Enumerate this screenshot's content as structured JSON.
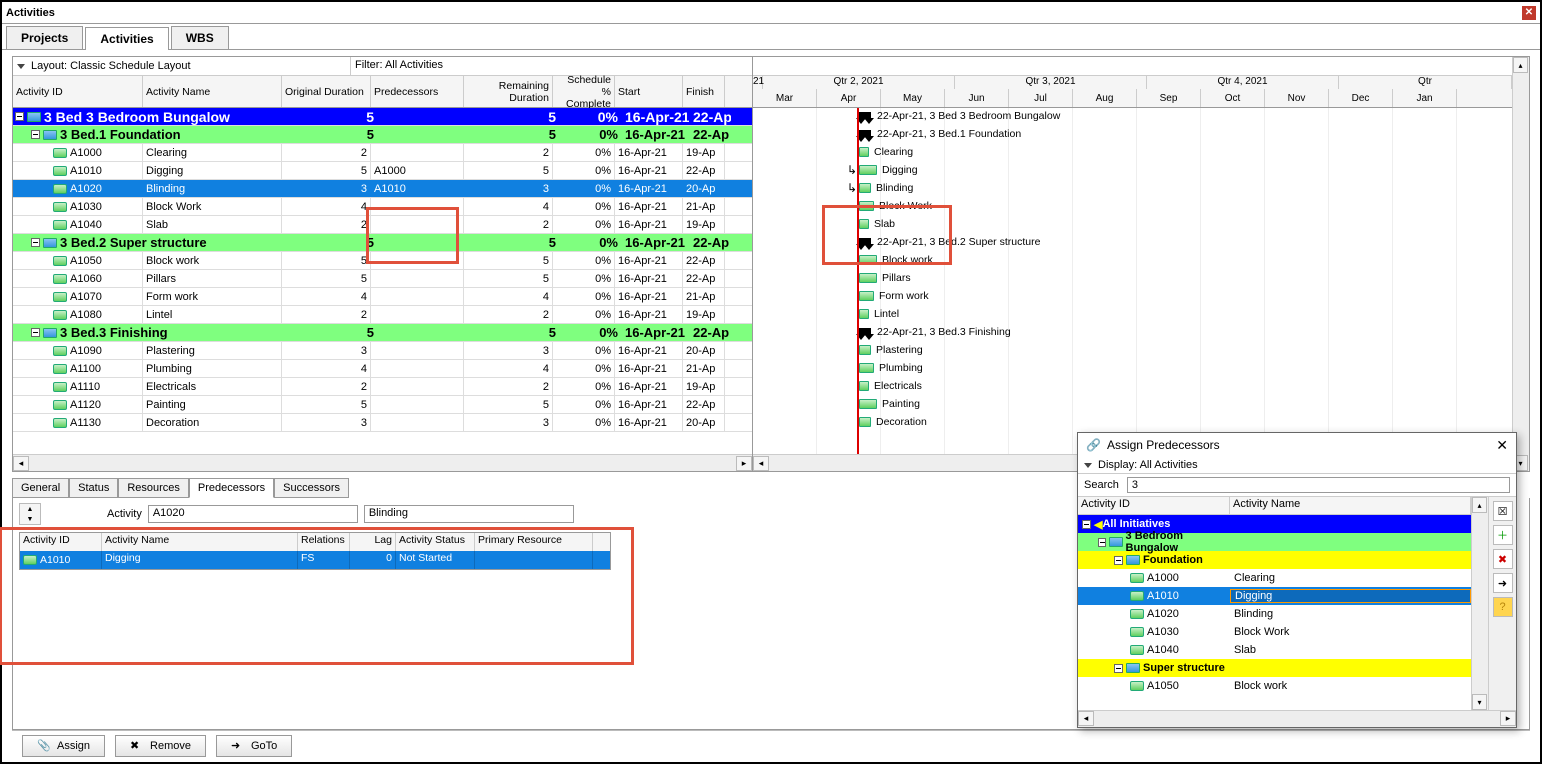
{
  "window": {
    "title": "Activities"
  },
  "tabs": [
    "Projects",
    "Activities",
    "WBS"
  ],
  "activeTab": 1,
  "layoutBar": {
    "layout": "Layout: Classic Schedule Layout",
    "filter": "Filter: All Activities"
  },
  "columns": {
    "id": "Activity ID",
    "name": "Activity Name",
    "od": "Original Duration",
    "pred": "Predecessors",
    "rd": "Remaining Duration",
    "sc": "Schedule % Complete",
    "start": "Start",
    "finish": "Finish"
  },
  "rows": [
    {
      "type": "wbs0",
      "indent": 0,
      "id": "3 Bed",
      "name": "3 Bedroom Bungalow",
      "od": "5",
      "pred": "",
      "rd": "5",
      "sc": "0%",
      "start": "16-Apr-21",
      "finish": "22-Ap"
    },
    {
      "type": "wbs1",
      "indent": 1,
      "id": "3 Bed.1",
      "name": "Foundation",
      "od": "5",
      "pred": "",
      "rd": "5",
      "sc": "0%",
      "start": "16-Apr-21",
      "finish": "22-Ap"
    },
    {
      "type": "act",
      "indent": 2,
      "id": "A1000",
      "name": "Clearing",
      "od": "2",
      "pred": "",
      "rd": "2",
      "sc": "0%",
      "start": "16-Apr-21",
      "finish": "19-Ap"
    },
    {
      "type": "act",
      "indent": 2,
      "id": "A1010",
      "name": "Digging",
      "od": "5",
      "pred": "A1000",
      "rd": "5",
      "sc": "0%",
      "start": "16-Apr-21",
      "finish": "22-Ap"
    },
    {
      "type": "sel",
      "indent": 2,
      "id": "A1020",
      "name": "Blinding",
      "od": "3",
      "pred": "A1010",
      "rd": "3",
      "sc": "0%",
      "start": "16-Apr-21",
      "finish": "20-Ap"
    },
    {
      "type": "act",
      "indent": 2,
      "id": "A1030",
      "name": "Block Work",
      "od": "4",
      "pred": "",
      "rd": "4",
      "sc": "0%",
      "start": "16-Apr-21",
      "finish": "21-Ap"
    },
    {
      "type": "act",
      "indent": 2,
      "id": "A1040",
      "name": "Slab",
      "od": "2",
      "pred": "",
      "rd": "2",
      "sc": "0%",
      "start": "16-Apr-21",
      "finish": "19-Ap"
    },
    {
      "type": "wbs1",
      "indent": 1,
      "id": "3 Bed.2",
      "name": "Super structure",
      "od": "5",
      "pred": "",
      "rd": "5",
      "sc": "0%",
      "start": "16-Apr-21",
      "finish": "22-Ap"
    },
    {
      "type": "act",
      "indent": 2,
      "id": "A1050",
      "name": "Block work",
      "od": "5",
      "pred": "",
      "rd": "5",
      "sc": "0%",
      "start": "16-Apr-21",
      "finish": "22-Ap"
    },
    {
      "type": "act",
      "indent": 2,
      "id": "A1060",
      "name": "Pillars",
      "od": "5",
      "pred": "",
      "rd": "5",
      "sc": "0%",
      "start": "16-Apr-21",
      "finish": "22-Ap"
    },
    {
      "type": "act",
      "indent": 2,
      "id": "A1070",
      "name": "Form work",
      "od": "4",
      "pred": "",
      "rd": "4",
      "sc": "0%",
      "start": "16-Apr-21",
      "finish": "21-Ap"
    },
    {
      "type": "act",
      "indent": 2,
      "id": "A1080",
      "name": "Lintel",
      "od": "2",
      "pred": "",
      "rd": "2",
      "sc": "0%",
      "start": "16-Apr-21",
      "finish": "19-Ap"
    },
    {
      "type": "wbs1",
      "indent": 1,
      "id": "3 Bed.3",
      "name": "Finishing",
      "od": "5",
      "pred": "",
      "rd": "5",
      "sc": "0%",
      "start": "16-Apr-21",
      "finish": "22-Ap"
    },
    {
      "type": "act",
      "indent": 2,
      "id": "A1090",
      "name": "Plastering",
      "od": "3",
      "pred": "",
      "rd": "3",
      "sc": "0%",
      "start": "16-Apr-21",
      "finish": "20-Ap"
    },
    {
      "type": "act",
      "indent": 2,
      "id": "A1100",
      "name": "Plumbing",
      "od": "4",
      "pred": "",
      "rd": "4",
      "sc": "0%",
      "start": "16-Apr-21",
      "finish": "21-Ap"
    },
    {
      "type": "act",
      "indent": 2,
      "id": "A1110",
      "name": "Electricals",
      "od": "2",
      "pred": "",
      "rd": "2",
      "sc": "0%",
      "start": "16-Apr-21",
      "finish": "19-Ap"
    },
    {
      "type": "act",
      "indent": 2,
      "id": "A1120",
      "name": "Painting",
      "od": "5",
      "pred": "",
      "rd": "5",
      "sc": "0%",
      "start": "16-Apr-21",
      "finish": "22-Ap"
    },
    {
      "type": "act",
      "indent": 2,
      "id": "A1130",
      "name": "Decoration",
      "od": "3",
      "pred": "",
      "rd": "3",
      "sc": "0%",
      "start": "16-Apr-21",
      "finish": "20-Ap"
    }
  ],
  "timeline": {
    "yearLabel": "21",
    "quarters": [
      "Qtr 2, 2021",
      "Qtr 3, 2021",
      "Qtr 4, 2021",
      "Qtr"
    ],
    "months": [
      "Mar",
      "Apr",
      "May",
      "Jun",
      "Jul",
      "Aug",
      "Sep",
      "Oct",
      "Nov",
      "Dec",
      "Jan"
    ]
  },
  "gantt": [
    {
      "type": "sum",
      "label": "22-Apr-21, 3 Bed  3 Bedroom Bungalow"
    },
    {
      "type": "sum",
      "label": "22-Apr-21, 3 Bed.1  Foundation"
    },
    {
      "type": "bar",
      "w": 10,
      "label": "Clearing"
    },
    {
      "type": "bar",
      "w": 18,
      "label": "Digging",
      "link": 1
    },
    {
      "type": "bar",
      "w": 12,
      "label": "Blinding",
      "link": 1
    },
    {
      "type": "bar",
      "w": 15,
      "label": "Block Work"
    },
    {
      "type": "bar",
      "w": 10,
      "label": "Slab"
    },
    {
      "type": "sum",
      "label": "22-Apr-21, 3 Bed.2  Super structure"
    },
    {
      "type": "bar",
      "w": 18,
      "label": "Block work"
    },
    {
      "type": "bar",
      "w": 18,
      "label": "Pillars"
    },
    {
      "type": "bar",
      "w": 15,
      "label": "Form work"
    },
    {
      "type": "bar",
      "w": 10,
      "label": "Lintel"
    },
    {
      "type": "sum",
      "label": "22-Apr-21, 3 Bed.3  Finishing"
    },
    {
      "type": "bar",
      "w": 12,
      "label": "Plastering"
    },
    {
      "type": "bar",
      "w": 15,
      "label": "Plumbing"
    },
    {
      "type": "bar",
      "w": 10,
      "label": "Electricals"
    },
    {
      "type": "bar",
      "w": 18,
      "label": "Painting"
    },
    {
      "type": "bar",
      "w": 12,
      "label": "Decoration"
    }
  ],
  "detailTabs": [
    "General",
    "Status",
    "Resources",
    "Predecessors",
    "Successors"
  ],
  "activeDetailTab": 3,
  "detail": {
    "activityLabel": "Activity",
    "activityId": "A1020",
    "activityName": "Blinding",
    "predCols": {
      "id": "Activity ID",
      "name": "Activity Name",
      "rel": "Relations",
      "lag": "Lag",
      "stat": "Activity Status",
      "res": "Primary Resource"
    },
    "predRow": {
      "id": "A1010",
      "name": "Digging",
      "rel": "FS",
      "lag": "0",
      "stat": "Not Started",
      "res": ""
    }
  },
  "buttons": {
    "assign": "Assign",
    "remove": "Remove",
    "goto": "GoTo"
  },
  "dialog": {
    "title": "Assign Predecessors",
    "display": "Display: All Activities",
    "searchLabel": "Search",
    "searchValue": "3",
    "col1": "Activity ID",
    "col2": "Activity Name",
    "tree": [
      {
        "style": "blue",
        "indent": 0,
        "id": "All  Initiatives",
        "name": ""
      },
      {
        "style": "green",
        "indent": 1,
        "id": "3 Bedroom Bungalow",
        "name": ""
      },
      {
        "style": "yellow",
        "indent": 2,
        "id": "Foundation",
        "name": ""
      },
      {
        "style": "act",
        "indent": 3,
        "id": "A1000",
        "name": "Clearing"
      },
      {
        "style": "sel",
        "indent": 3,
        "id": "A1010",
        "name": "Digging"
      },
      {
        "style": "act",
        "indent": 3,
        "id": "A1020",
        "name": "Blinding"
      },
      {
        "style": "act",
        "indent": 3,
        "id": "A1030",
        "name": "Block Work"
      },
      {
        "style": "act",
        "indent": 3,
        "id": "A1040",
        "name": "Slab"
      },
      {
        "style": "yellow",
        "indent": 2,
        "id": "Super structure",
        "name": ""
      },
      {
        "style": "act",
        "indent": 3,
        "id": "A1050",
        "name": "Block work"
      }
    ],
    "toolbar": [
      "close",
      "add",
      "del",
      "goto",
      "help"
    ]
  }
}
